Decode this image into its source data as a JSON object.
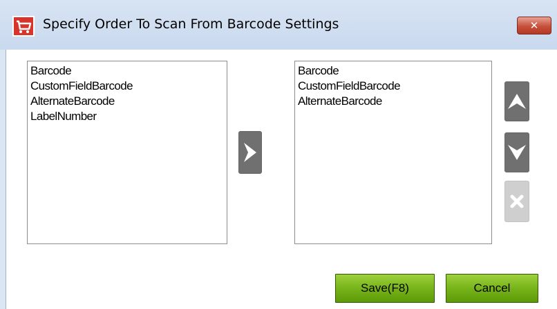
{
  "window": {
    "title": "Specify Order To Scan From Barcode Settings",
    "close_icon": "close-icon",
    "app_icon": "shopping-cart-icon"
  },
  "available_fields": {
    "items": [
      "Barcode",
      "CustomFieldBarcode",
      "AlternateBarcode",
      "LabelNumber"
    ]
  },
  "scan_order": {
    "items": [
      "Barcode",
      "CustomFieldBarcode",
      "AlternateBarcode"
    ]
  },
  "buttons": {
    "move_right_icon": "chevron-right-icon",
    "move_up_icon": "chevron-up-icon",
    "move_down_icon": "chevron-down-icon",
    "remove_icon": "remove-icon",
    "save_label": "Save(F8)",
    "cancel_label": "Cancel"
  },
  "colors": {
    "accent_green": "#77b41a",
    "close_red": "#c7503a",
    "icon_button_gray": "#707070",
    "icon_button_disabled": "#cfcfcf"
  }
}
